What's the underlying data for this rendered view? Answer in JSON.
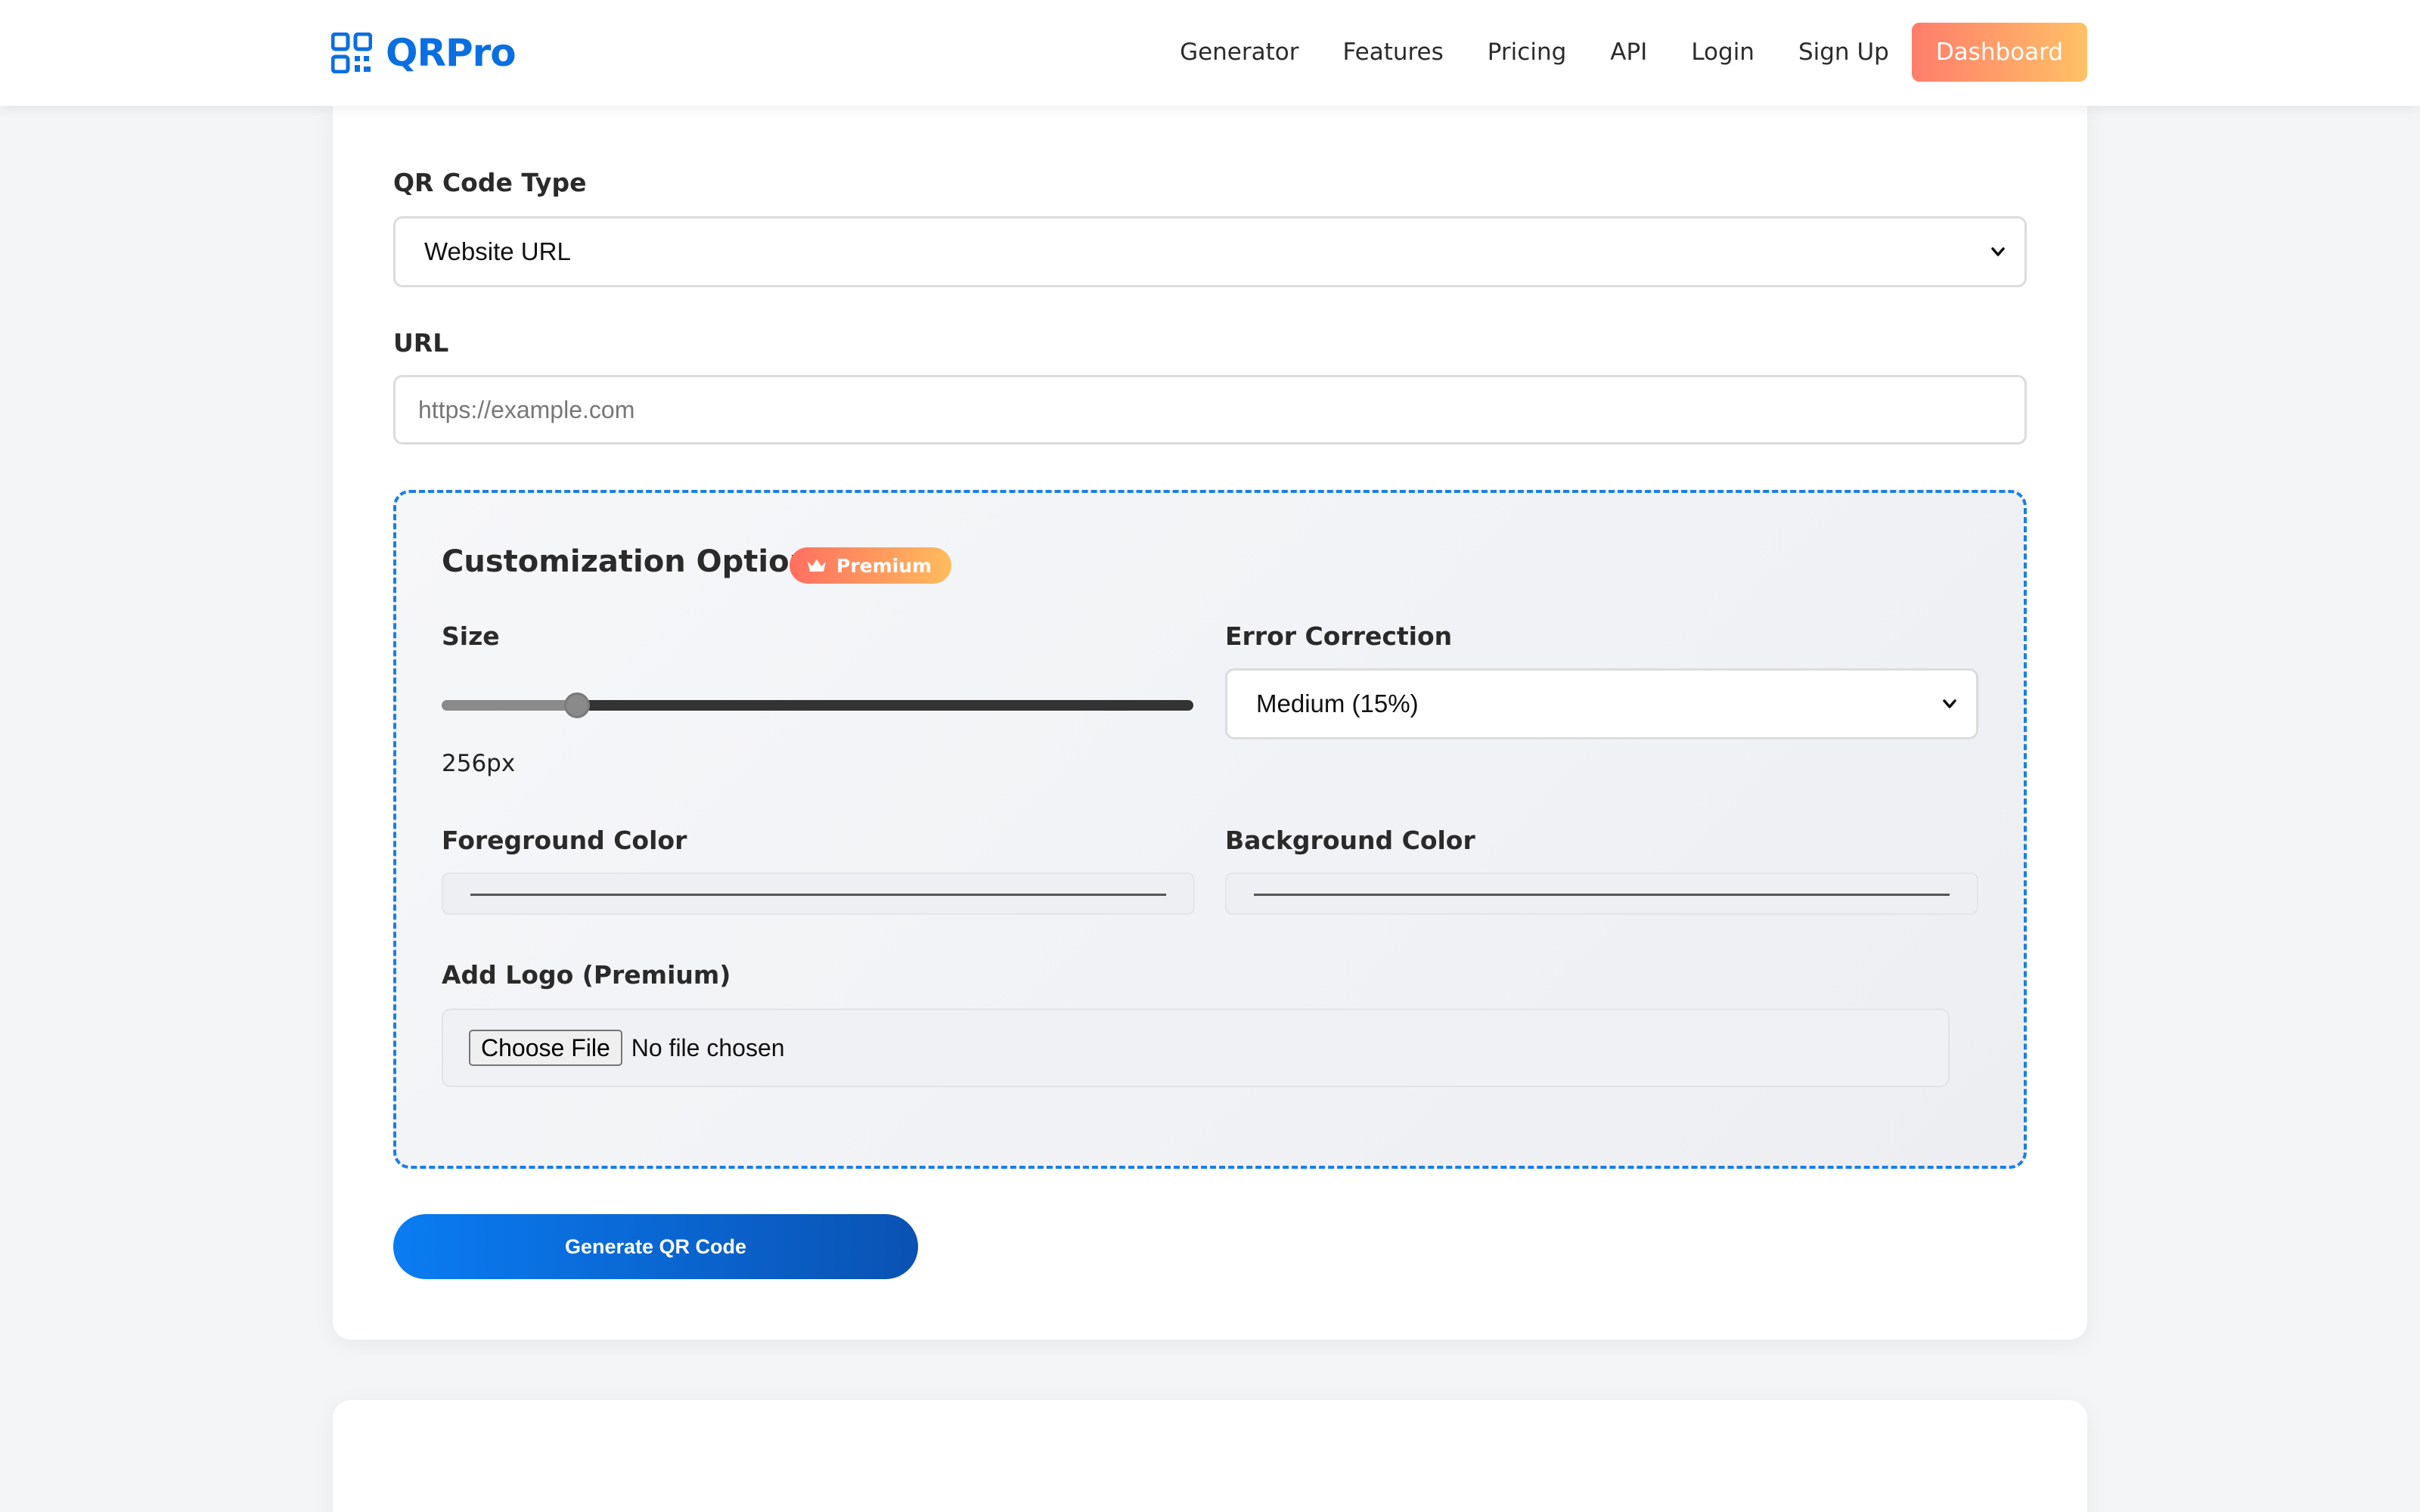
{
  "nav": {
    "brand": "QRPro",
    "links": [
      "Generator",
      "Features",
      "Pricing",
      "API",
      "Login",
      "Sign Up"
    ],
    "dashboard": "Dashboard"
  },
  "form": {
    "type_label": "QR Code Type",
    "type_value": "Website URL",
    "url_label": "URL",
    "url_placeholder": "https://example.com"
  },
  "custom": {
    "title": "Customization Options",
    "badge": "Premium",
    "size_label": "Size",
    "size_value": "256px",
    "size_fraction": 0.18,
    "ec_label": "Error Correction",
    "ec_value": "Medium (15%)",
    "fg_label": "Foreground Color",
    "bg_label": "Background Color",
    "logo_label": "Add Logo (Premium)",
    "file_button": "Choose File",
    "file_status": "No file chosen"
  },
  "actions": {
    "generate": "Generate QR Code"
  },
  "colors": {
    "brand": "#0a6fe0",
    "accent_start": "#ff7d6b",
    "accent_end": "#ffc166",
    "primary_button": "#0a7cf2"
  }
}
